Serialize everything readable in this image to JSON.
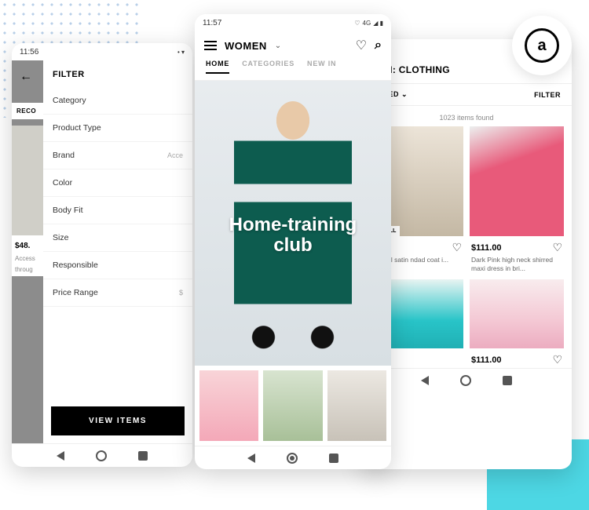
{
  "phone1": {
    "time": "11:56",
    "dim": {
      "reco": "RECO",
      "price": "$48.",
      "desc1": "Access",
      "desc2": "throug"
    },
    "panel_title": "FILTER",
    "filters": [
      {
        "label": "Category",
        "val": ""
      },
      {
        "label": "Product Type",
        "val": ""
      },
      {
        "label": "Brand",
        "val": "Acce"
      },
      {
        "label": "Color",
        "val": ""
      },
      {
        "label": "Body Fit",
        "val": ""
      },
      {
        "label": "Size",
        "val": ""
      },
      {
        "label": "Responsible",
        "val": ""
      },
      {
        "label": "Price Range",
        "val": "$"
      }
    ],
    "view_btn": "VIEW ITEMS"
  },
  "phone2": {
    "time": "11:57",
    "net": "4G",
    "title": "WOMEN",
    "tabs": [
      "HOME",
      "CATEGORIES",
      "NEW IN"
    ],
    "hero_line1": "Home-training",
    "hero_line2": "club"
  },
  "phone3": {
    "header": "W IN: CLOTHING",
    "sort": "ENDED",
    "filter": "FILTER",
    "count": "1023 items found",
    "products": [
      {
        "tag": "OS TALL",
        "price": "",
        "name": "GN Tall satin\nndad coat i..."
      },
      {
        "tag": "",
        "price": "$111.00",
        "name": "Dark Pink high neck shirred maxi dress in bri..."
      },
      {
        "tag": "",
        "price": "",
        "name": ""
      },
      {
        "tag": "",
        "price": "$111.00",
        "name": ""
      }
    ]
  },
  "logo": "a"
}
